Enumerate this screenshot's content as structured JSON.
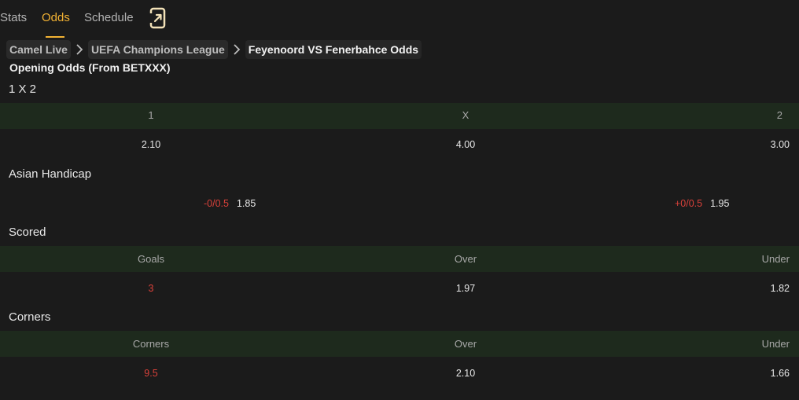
{
  "tabs": [
    {
      "label": "Stats"
    },
    {
      "label": "Odds"
    },
    {
      "label": "Schedule"
    }
  ],
  "breadcrumb": [
    "Camel Live",
    "UEFA Champions League",
    "Feyenoord VS Fenerbahce Odds"
  ],
  "heading": "Opening Odds (From BETXXX)",
  "one_x_two": {
    "title": "1 X 2",
    "headers": [
      "1",
      "X",
      "2"
    ],
    "values": [
      "2.10",
      "4.00",
      "3.00"
    ]
  },
  "asian_handicap": {
    "title": "Asian Handicap",
    "home": {
      "handicap": "-0/0.5",
      "odds": "1.85"
    },
    "away": {
      "handicap": "+0/0.5",
      "odds": "1.95"
    }
  },
  "scored": {
    "title": "Scored",
    "headers": [
      "Goals",
      "Over",
      "Under"
    ],
    "values": [
      "3",
      "1.97",
      "1.82"
    ]
  },
  "corners": {
    "title": "Corners",
    "headers": [
      "Corners",
      "Over",
      "Under"
    ],
    "values": [
      "9.5",
      "2.10",
      "1.66"
    ]
  },
  "colors": {
    "accent": "#f2b233",
    "band": "#1e2a1d",
    "negative": "#d9413a",
    "background": "#1b1b1b"
  },
  "icons": [
    "share-icon",
    "chevron-right-icon"
  ]
}
